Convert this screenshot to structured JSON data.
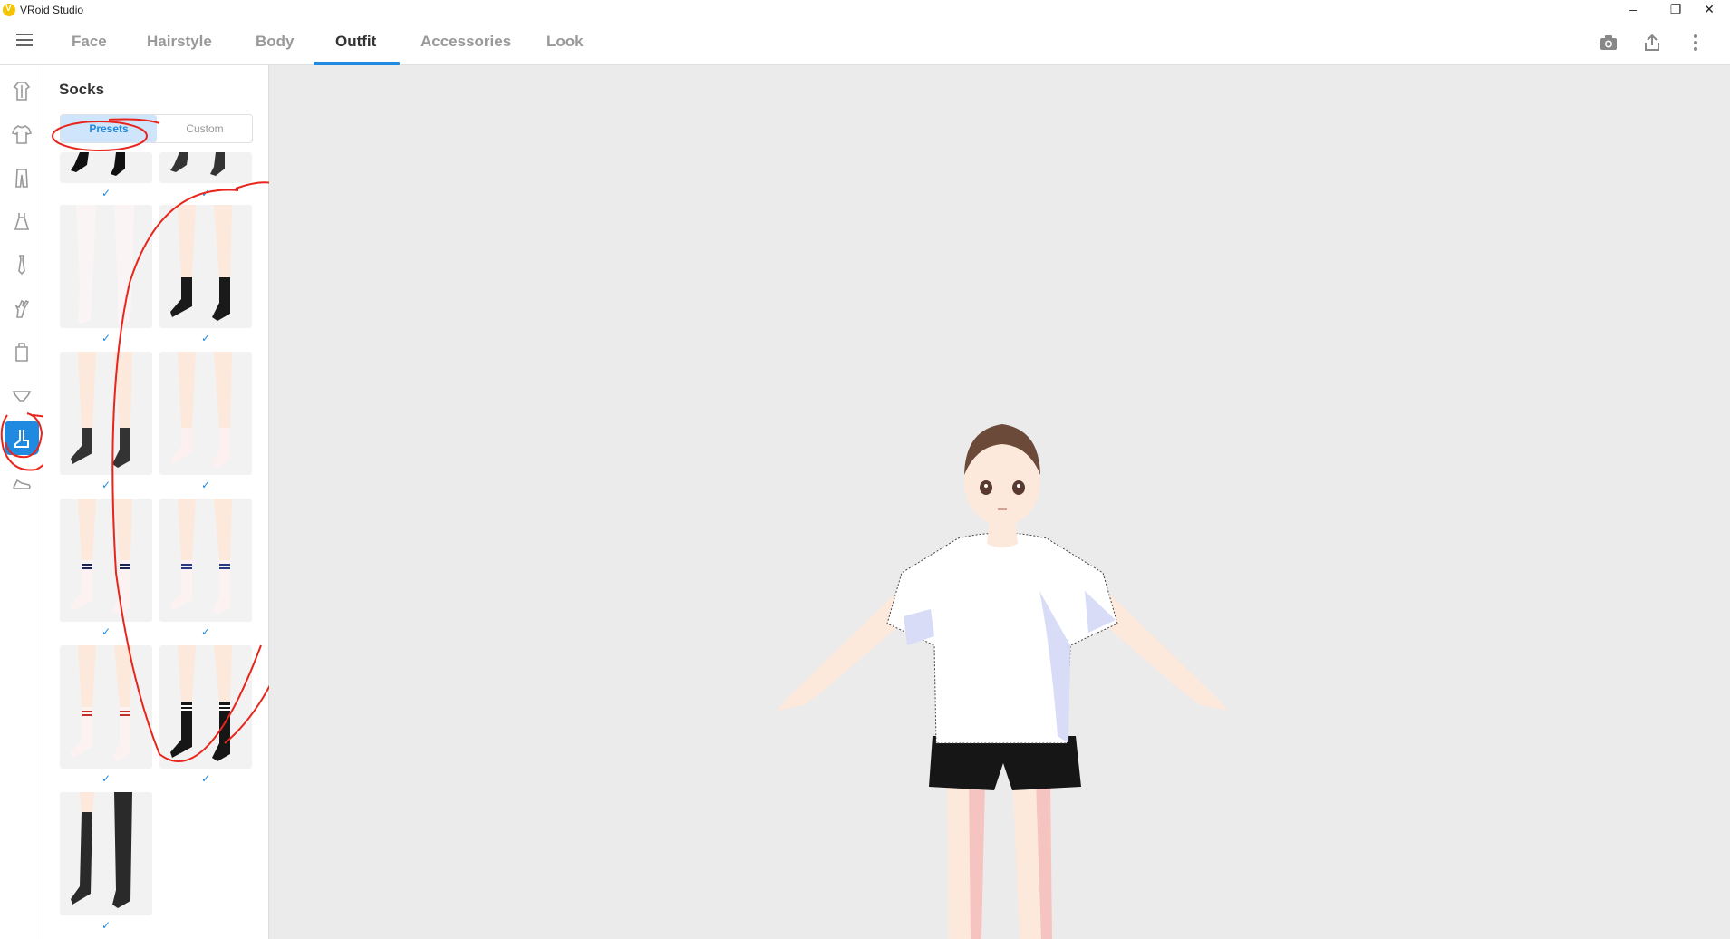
{
  "window": {
    "title": "VRoid Studio",
    "minimize_glyph": "–",
    "maximize_glyph": "❐",
    "close_glyph": "✕"
  },
  "nav": {
    "tabs": [
      {
        "label": "Face"
      },
      {
        "label": "Hairstyle"
      },
      {
        "label": "Body"
      },
      {
        "label": "Outfit"
      },
      {
        "label": "Accessories"
      },
      {
        "label": "Look"
      }
    ],
    "active_tab": "Outfit",
    "tools": [
      "camera-icon",
      "export-icon",
      "more-vertical-icon"
    ]
  },
  "sidebar": {
    "categories": [
      "coat-icon",
      "tshirt-icon",
      "pants-icon",
      "onepiece-icon",
      "necktie-icon",
      "glove-icon",
      "bag-icon",
      "underwear-icon",
      "socks-icon",
      "shoes-icon"
    ],
    "active_category": "socks-icon"
  },
  "panel": {
    "title": "Socks",
    "segments": {
      "presets": "Presets",
      "custom": "Custom"
    },
    "check_glyph": "✓",
    "presets": [
      {
        "name": "ankle-black",
        "selected": true
      },
      {
        "name": "ankle-gray",
        "selected": true
      },
      {
        "name": "thigh-white",
        "selected": true
      },
      {
        "name": "crew-black",
        "selected": true
      },
      {
        "name": "crew-gray",
        "selected": true
      },
      {
        "name": "crew-white",
        "selected": true
      },
      {
        "name": "stripe-white-navy",
        "selected": true
      },
      {
        "name": "stripe-white-navy-2",
        "selected": true
      },
      {
        "name": "stripe-white-red",
        "selected": true
      },
      {
        "name": "stripe-black-white",
        "selected": true
      },
      {
        "name": "thigh-black",
        "selected": true
      }
    ]
  },
  "colors": {
    "accent": "#1f8ae0",
    "annotation": "#e8251c",
    "shirt": "#ffffff",
    "shorts": "#161616",
    "hair": "#6b4a3a",
    "skin": "#fde8dc"
  }
}
